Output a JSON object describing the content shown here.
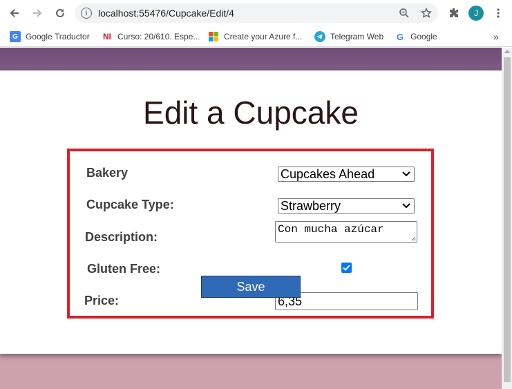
{
  "browser": {
    "url": "localhost:55476/Cupcake/Edit/4",
    "profile_initial": "J",
    "bookmarks": [
      {
        "label": "Google Traductor",
        "icon": "google-translate-icon"
      },
      {
        "label": "Curso: 20/610. Espe...",
        "icon": "ni-icon"
      },
      {
        "label": "Create your Azure f...",
        "icon": "microsoft-icon"
      },
      {
        "label": "Telegram Web",
        "icon": "telegram-icon"
      },
      {
        "label": "Google",
        "icon": "google-icon"
      }
    ],
    "more_bookmarks": "»"
  },
  "page": {
    "title": "Edit a Cupcake",
    "form": {
      "bakery_label": "Bakery",
      "bakery_value": "Cupcakes Ahead",
      "type_label": "Cupcake Type:",
      "type_value": "Strawberry",
      "description_label": "Description:",
      "description_value": "Con mucha azúcar",
      "gluten_label": "Gluten Free:",
      "gluten_checked": true,
      "price_label": "Price:",
      "price_value": "6,35"
    },
    "save_label": "Save"
  },
  "colors": {
    "highlight_border": "#d9212a",
    "save_button": "#2f6ab6",
    "checkbox": "#0075ff",
    "page_background": "#cea1ae",
    "header_band": "#6e4e78"
  }
}
